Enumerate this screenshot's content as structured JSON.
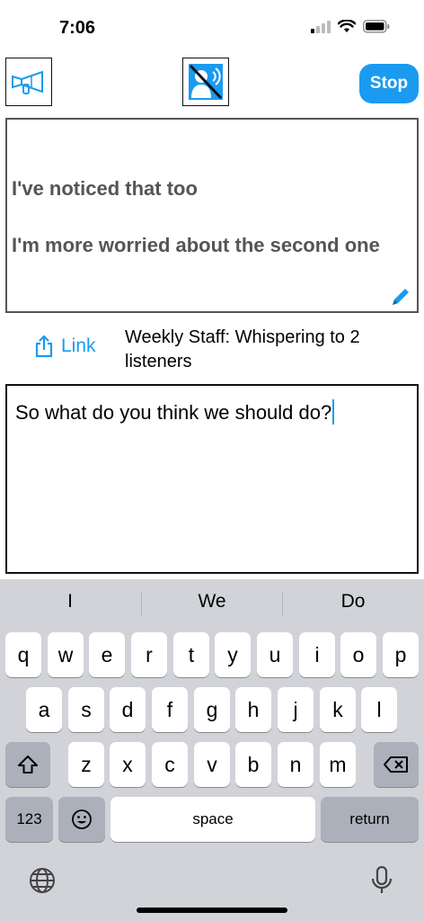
{
  "status": {
    "time": "7:06"
  },
  "toolbar": {
    "left_icon": "horn-icon",
    "mute_icon": "muted-speaker-icon",
    "stop_label": "Stop"
  },
  "transcript": {
    "lines": [
      "I've noticed that too",
      "I'm more worried about the second one"
    ]
  },
  "link": {
    "label": "Link"
  },
  "session": {
    "title": "Weekly Staff: Whispering to 2 listeners"
  },
  "compose": {
    "text": "So what do you think we should do?"
  },
  "keyboard": {
    "suggestions": [
      "I",
      "We",
      "Do"
    ],
    "row1": [
      "q",
      "w",
      "e",
      "r",
      "t",
      "y",
      "u",
      "i",
      "o",
      "p"
    ],
    "row2": [
      "a",
      "s",
      "d",
      "f",
      "g",
      "h",
      "j",
      "k",
      "l"
    ],
    "row3": [
      "z",
      "x",
      "c",
      "v",
      "b",
      "n",
      "m"
    ],
    "numbers_label": "123",
    "space_label": "space",
    "return_label": "return"
  },
  "colors": {
    "accent": "#1a9bf0",
    "keyboard_bg": "#d1d3d9"
  }
}
